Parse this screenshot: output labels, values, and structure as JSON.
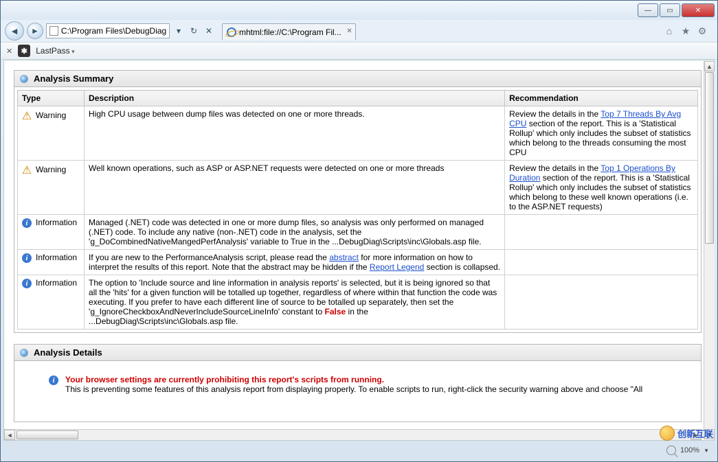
{
  "window": {
    "address_path": "C:\\Program Files\\DebugDiag\\R",
    "tab_title": "mhtml:file://C:\\Program Fil...",
    "zoom_label": "100%"
  },
  "toolbar": {
    "lastpass": "LastPass"
  },
  "summary": {
    "title": "Analysis Summary",
    "cols": {
      "c1": "Type",
      "c2": "Description",
      "c3": "Recommendation"
    },
    "rows": [
      {
        "type_label": "Warning",
        "icon": "warn",
        "desc": "High CPU usage between dump files was detected on one or more threads.",
        "rec_pre": "Review the details in the ",
        "rec_link": "Top 7 Threads By Avg CPU",
        "rec_post": " section of the report. This is a 'Statistical Rollup' which only includes the subset of statistics which belong to the threads consuming the most CPU"
      },
      {
        "type_label": "Warning",
        "icon": "warn",
        "desc": "Well known operations, such as ASP or ASP.NET requests were detected on one or more threads",
        "rec_pre": "Review the details in the ",
        "rec_link": "Top 1 Operations By Duration",
        "rec_post": " section of the report. This is a 'Statistical Rollup' which only includes the subset of statistics which belong to these well known operations (i.e. to the ASP.NET requests)"
      },
      {
        "type_label": "Information",
        "icon": "info",
        "desc": "Managed (.NET) code was detected in one or more dump files, so analysis was only performed on managed (.NET) code. To include any native (non-.NET) code in the analysis, set the 'g_DoCombinedNativeMangedPerfAnalysis' variable to True in the ...DebugDiag\\Scripts\\inc\\Globals.asp file.",
        "rec_pre": "",
        "rec_link": "",
        "rec_post": ""
      },
      {
        "type_label": "Information",
        "icon": "info",
        "desc_pre": "If you are new to the PerformanceAnalysis script, please read the ",
        "desc_link1": "abstract",
        "desc_mid": " for more information on how to interpret the results of this report.   Note that the abstract may be hidden if the ",
        "desc_link2": "Report Legend",
        "desc_post": " section is collapsed.",
        "rec_pre": "",
        "rec_link": "",
        "rec_post": ""
      },
      {
        "type_label": "Information",
        "icon": "info",
        "desc_pre": "The option to 'Include source and line information in analysis reports' is selected, but it is being ignored so that all the 'hits' for a given function will be totalled up together, regardless of where within that function the code was executing. If you prefer to have each different line of source to be totalled up separately, then set the 'g_IgnoreCheckboxAndNeverIncludeSourceLineInfo' constant to ",
        "desc_false": "False",
        "desc_post": " in the ...DebugDiag\\Scripts\\inc\\Globals.asp file.",
        "rec_pre": "",
        "rec_link": "",
        "rec_post": ""
      }
    ]
  },
  "details": {
    "title": "Analysis Details",
    "err_head": "Your browser settings are currently prohibiting this report's scripts from running.",
    "err_body": "This is preventing some features of this analysis report from displaying properly. To enable scripts to run, right-click the security warning above and choose \"All"
  },
  "watermark": "创新互联"
}
